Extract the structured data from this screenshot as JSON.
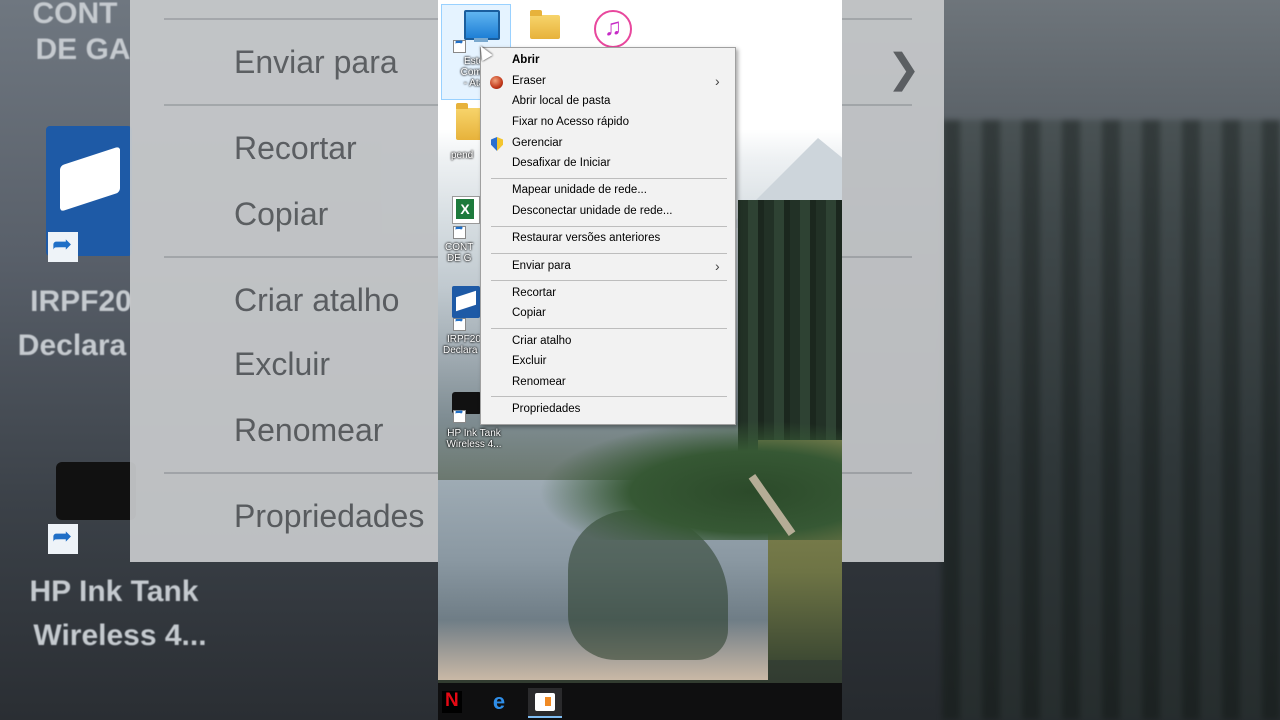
{
  "background_zoom": {
    "left_labels": [
      "CONT",
      "DE GA",
      "IRPF20",
      "Declara",
      "HP Ink Tank",
      "Wireless 4..."
    ],
    "menu_items": [
      "Enviar para",
      "Recortar",
      "Copiar",
      "Criar atalho",
      "Excluir",
      "Renomear",
      "Propriedades"
    ]
  },
  "desktop_icons": {
    "pc_label": [
      "Este",
      "Comp",
      "- Ata"
    ],
    "folder2_label": "pend",
    "excel_label": [
      "CONT",
      "DE G"
    ],
    "irpf_label": [
      "IRPF20",
      "Declara"
    ],
    "printer_label": [
      "HP Ink Tank",
      "Wireless 4..."
    ]
  },
  "context_menu": {
    "open": "Abrir",
    "eraser": "Eraser",
    "open_location": "Abrir local de pasta",
    "pin_quick": "Fixar no Acesso rápido",
    "manage": "Gerenciar",
    "unpin_start": "Desafixar de Iniciar",
    "map_drive": "Mapear unidade de rede...",
    "disconnect_drive": "Desconectar unidade de rede...",
    "restore_versions": "Restaurar versões anteriores",
    "send_to": "Enviar para",
    "cut": "Recortar",
    "copy": "Copiar",
    "create_shortcut": "Criar atalho",
    "delete": "Excluir",
    "rename": "Renomear",
    "properties": "Propriedades"
  },
  "taskbar": {
    "netflix_glyph": "N",
    "edge_glyph": "e"
  },
  "icons": [
    "this-pc-icon",
    "folder-icon",
    "itunes-icon",
    "excel-icon",
    "irpf-icon",
    "printer-icon",
    "eraser-icon",
    "shield-icon",
    "netflix-icon",
    "edge-icon",
    "app-icon"
  ]
}
